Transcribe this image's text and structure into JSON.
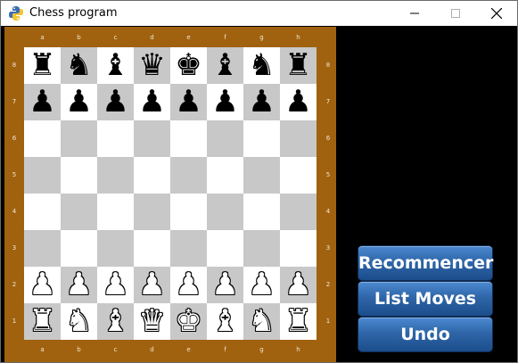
{
  "window": {
    "title": "Chess program"
  },
  "board": {
    "files": [
      "a",
      "b",
      "c",
      "d",
      "e",
      "f",
      "g",
      "h"
    ],
    "ranks": [
      "8",
      "7",
      "6",
      "5",
      "4",
      "3",
      "2",
      "1"
    ],
    "colors": {
      "frame": "#a0620f",
      "light": "#ffffff",
      "dark": "#c8c8c8"
    },
    "rows": [
      [
        "♜",
        "♞",
        "♝",
        "♛",
        "♚",
        "♝",
        "♞",
        "♜"
      ],
      [
        "♟",
        "♟",
        "♟",
        "♟",
        "♟",
        "♟",
        "♟",
        "♟"
      ],
      [
        "",
        "",
        "",
        "",
        "",
        "",
        "",
        ""
      ],
      [
        "",
        "",
        "",
        "",
        "",
        "",
        "",
        ""
      ],
      [
        "",
        "",
        "",
        "",
        "",
        "",
        "",
        ""
      ],
      [
        "",
        "",
        "",
        "",
        "",
        "",
        "",
        ""
      ],
      [
        "♟",
        "♟",
        "♟",
        "♟",
        "♟",
        "♟",
        "♟",
        "♟"
      ],
      [
        "♜",
        "♞",
        "♝",
        "♛",
        "♚",
        "♝",
        "♞",
        "♜"
      ]
    ],
    "piece_colors": [
      "black",
      "black",
      "",
      "",
      "",
      "",
      "white",
      "white"
    ]
  },
  "buttons": {
    "restart_label": "Recommencer",
    "list_moves_label": "List Moves",
    "undo_label": "Undo"
  }
}
